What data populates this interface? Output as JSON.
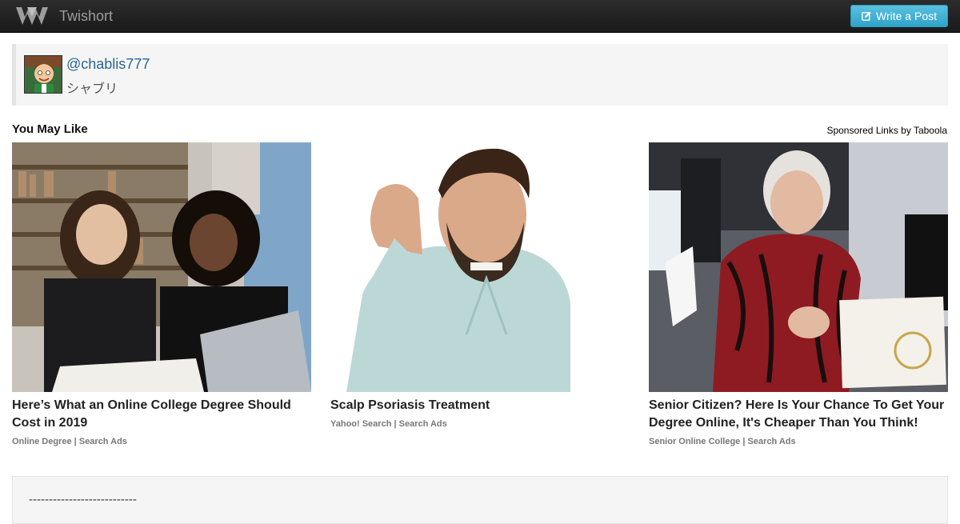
{
  "header": {
    "brand_name": "Twishort",
    "write_button_label": "Write a Post",
    "logo_icon": "twishort-logo-icon",
    "edit_icon": "pencil-square-icon"
  },
  "profile": {
    "handle": "@chablis777",
    "display_name": "シャブリ"
  },
  "recommendations": {
    "title": "You May Like",
    "sponsored_label": "Sponsored Links by Taboola",
    "cards": [
      {
        "headline": "Here’s What an Online College Degree Should Cost in 2019",
        "source": "Online Degree",
        "source_suffix": "Search Ads",
        "image_desc": "two-students-laptop-image"
      },
      {
        "headline": "Scalp Psoriasis Treatment",
        "source": "Yahoo! Search",
        "source_suffix": "Search Ads",
        "image_desc": "man-scratching-head-image"
      },
      {
        "headline": "Senior Citizen? Here Is Your Chance To Get Your Degree Online, It's Cheaper Than You Think!",
        "source": "Senior Online College",
        "source_suffix": "Search Ads",
        "image_desc": "elderly-woman-diploma-image"
      }
    ]
  },
  "post": {
    "text": "---------------------------"
  },
  "colors": {
    "navbar": "#222222",
    "button": "#5bc0de",
    "link": "#2a6496"
  }
}
